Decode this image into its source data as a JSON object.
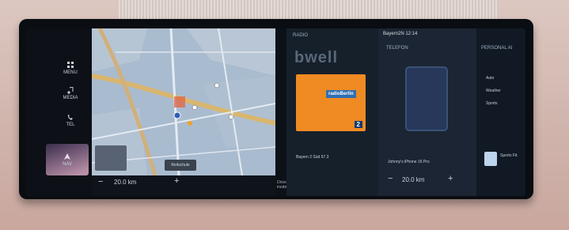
{
  "left_menu": {
    "items": [
      {
        "label": "MENU",
        "icon": "grid-icon"
      },
      {
        "label": "MEDIA",
        "icon": "music-note-icon"
      },
      {
        "label": "TEL",
        "icon": "phone-icon"
      },
      {
        "label": "NAV",
        "icon": "navigation-arrow-icon"
      }
    ]
  },
  "map": {
    "zoom": "20.0 km",
    "minus": "−",
    "plus": "+",
    "button_label": "Reitschule"
  },
  "divider_label": "Drive mode",
  "radio": {
    "header": "RADIO",
    "heading": "bwell",
    "card_logo": "radioBerlin",
    "card_number": "2",
    "station": "Bayern 2 Süd 97.3"
  },
  "status_bar": {
    "text": "Bayern2N  12:14"
  },
  "telephone": {
    "header": "TELEFON",
    "device": "Johnny's iPhone 16 Pro",
    "zoom": "20.0 km",
    "minus": "−",
    "plus": "+"
  },
  "personal": {
    "header": "PERSONAL AI",
    "items": [
      "Auto",
      "Weather",
      "Sports"
    ],
    "tile_label": "Sports Fit"
  },
  "colors": {
    "radio_card": "#f08a22",
    "menu_active": "#b98fa7",
    "map_water": "#9eb1c6"
  }
}
